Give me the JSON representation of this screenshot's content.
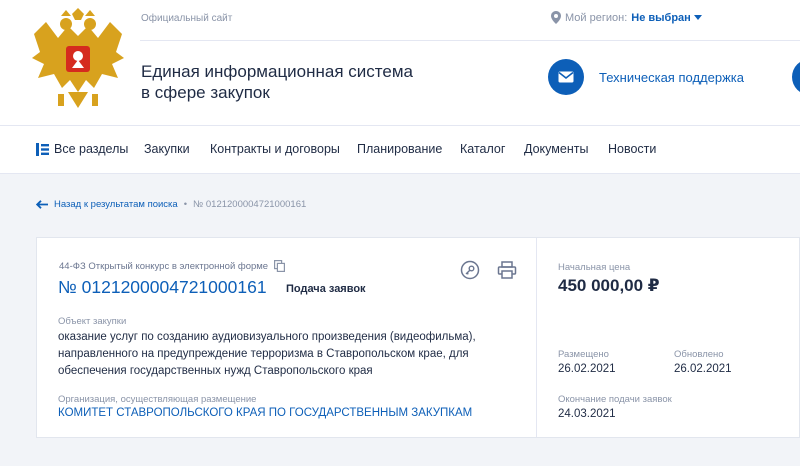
{
  "header": {
    "official_site": "Официальный сайт",
    "region_label": "Мой регион:",
    "region_value": "Не выбран",
    "site_title_line1": "Единая информационная система",
    "site_title_line2": "в сфере закупок",
    "support_label": "Техническая поддержка"
  },
  "nav": {
    "all_sections": "Все разделы",
    "items": [
      "Закупки",
      "Контракты и договоры",
      "Планирование",
      "Каталог",
      "Документы",
      "Новости"
    ]
  },
  "breadcrumb": {
    "back_label": "Назад к результатам поиска",
    "separator": "•",
    "current": "№ 0121200004721000161"
  },
  "card": {
    "law_type": "44-ФЗ Открытый конкурс в электронной форме",
    "number": "№ 0121200004721000161",
    "stage": "Подача заявок",
    "object_label": "Объект закупки",
    "object_lines": [
      "оказание услуг по созданию аудиовизуального произведения (видеофильма),",
      "направленного на предупреждение терроризма в Ставропольском крае, для",
      "обеспечения государственных нужд Ставропольского края"
    ],
    "org_label": "Организация, осуществляющая размещение",
    "org_name": "КОМИТЕТ СТАВРОПОЛЬСКОГО КРАЯ ПО ГОСУДАРСТВЕННЫМ ЗАКУПКАМ",
    "price_label": "Начальная цена",
    "price": "450 000,00 ₽",
    "posted_label": "Размещено",
    "posted_date": "26.02.2021",
    "updated_label": "Обновлено",
    "updated_date": "26.02.2021",
    "deadline_label": "Окончание подачи заявок",
    "deadline_date": "24.03.2021"
  },
  "colors": {
    "accent": "#0d5fb8",
    "text": "#1f2b44",
    "muted": "#8a94a8",
    "background": "#f2f4f8",
    "emblem_gold": "#d8a21e",
    "emblem_red": "#d52b1e"
  }
}
